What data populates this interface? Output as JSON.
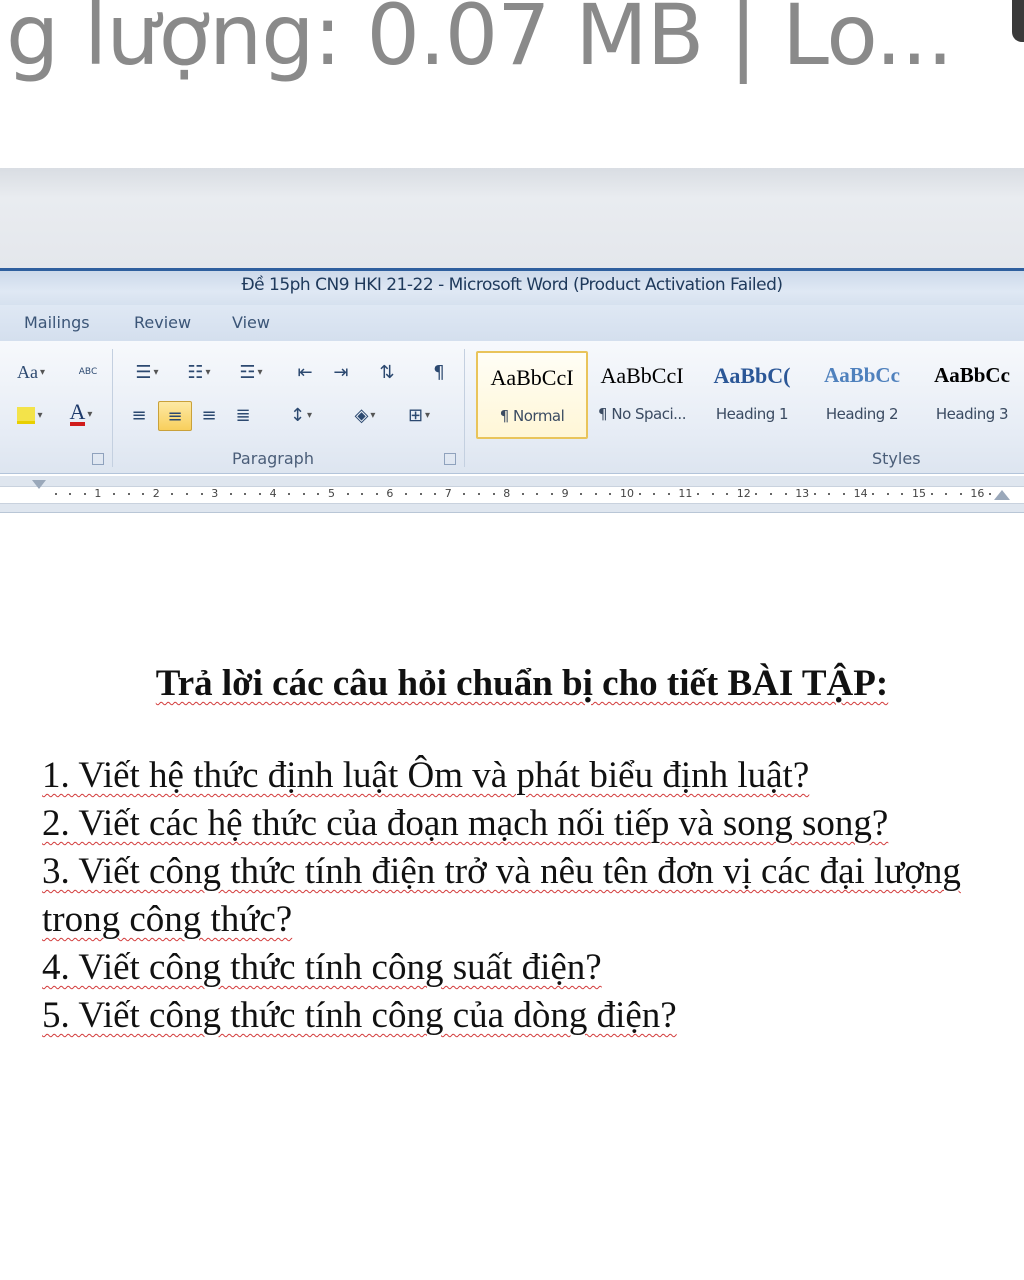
{
  "caption": {
    "text": "g lượng: 0.07 MB | Lo..."
  },
  "window": {
    "title": "Đề 15ph CN9 HKI 21-22  -  Microsoft Word (Product Activation Failed)"
  },
  "tabs": [
    "Mailings",
    "Review",
    "View"
  ],
  "ribbon": {
    "font_group": {
      "change_case_label": "Aa",
      "spelling_glyph": "ABC"
    },
    "paragraph_group": {
      "label": "Paragraph",
      "show_marks_glyph": "¶"
    },
    "styles_group": {
      "label": "Styles",
      "styles": [
        {
          "preview": "AaBbCcI",
          "name": "¶ Normal",
          "color": "#000000",
          "selected": true
        },
        {
          "preview": "AaBbCcI",
          "name": "¶ No Spaci...",
          "color": "#000000",
          "selected": false
        },
        {
          "preview": "AaBbC(",
          "name": "Heading 1",
          "color": "#2b5797",
          "selected": false
        },
        {
          "preview": "AaBbCc",
          "name": "Heading 2",
          "color": "#4f81bd",
          "selected": false
        },
        {
          "preview": "AaBbCc",
          "name": "Heading 3",
          "color": "#000000",
          "selected": false
        }
      ]
    }
  },
  "ruler": {
    "numbers": [
      "1",
      "2",
      "3",
      "4",
      "5",
      "6",
      "7",
      "8",
      "9",
      "10",
      "11",
      "12",
      "13",
      "14",
      "15",
      "16"
    ]
  },
  "document": {
    "heading": "Trả lời các câu hỏi chuẩn bị cho tiết BÀI TẬP:",
    "items": [
      "1. Viết hệ thức định luật Ôm và phát biểu định luật?",
      "2. Viết các hệ thức của đoạn mạch nối tiếp và song song?",
      "3. Viết công thức tính điện trở và nêu tên đơn vị các đại lượng trong công thức?",
      "4. Viết công thức tính công suất điện?",
      "5. Viết công thức tính công của dòng điện?"
    ]
  },
  "colors": {
    "title_blue": "#2f5f9e",
    "selected_style_border": "#e9c45a",
    "spellcheck_red": "#d23a3a"
  }
}
